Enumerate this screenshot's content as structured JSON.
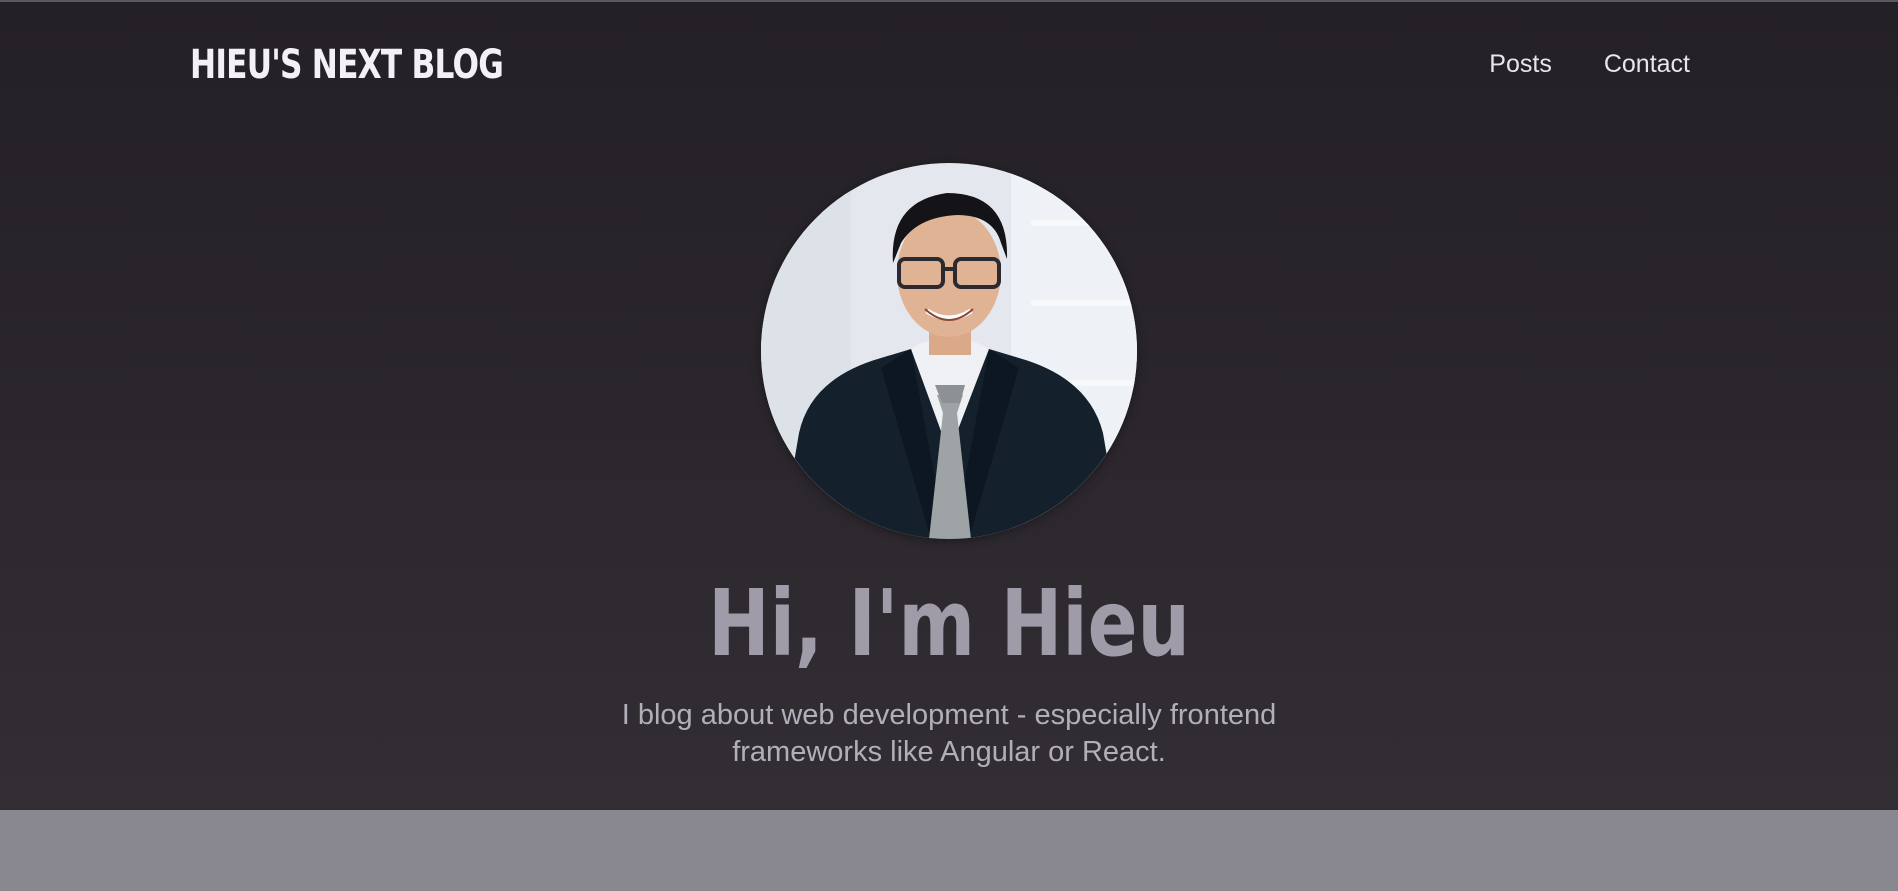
{
  "header": {
    "logo_text": "HIEU'S NEXT BLOG",
    "nav": [
      {
        "label": "Posts"
      },
      {
        "label": "Contact"
      }
    ]
  },
  "hero": {
    "avatar_alt": "Portrait photo of Hieu",
    "title": "Hi, I'm Hieu",
    "subtitle": "I blog about web development - especially frontend frameworks like Angular or React."
  },
  "colors": {
    "hero_bg": "#272329",
    "below_hero_bg": "#898790",
    "logo": "#f3f1f6",
    "title": "#a09ba9",
    "subtitle": "#b3afba"
  }
}
